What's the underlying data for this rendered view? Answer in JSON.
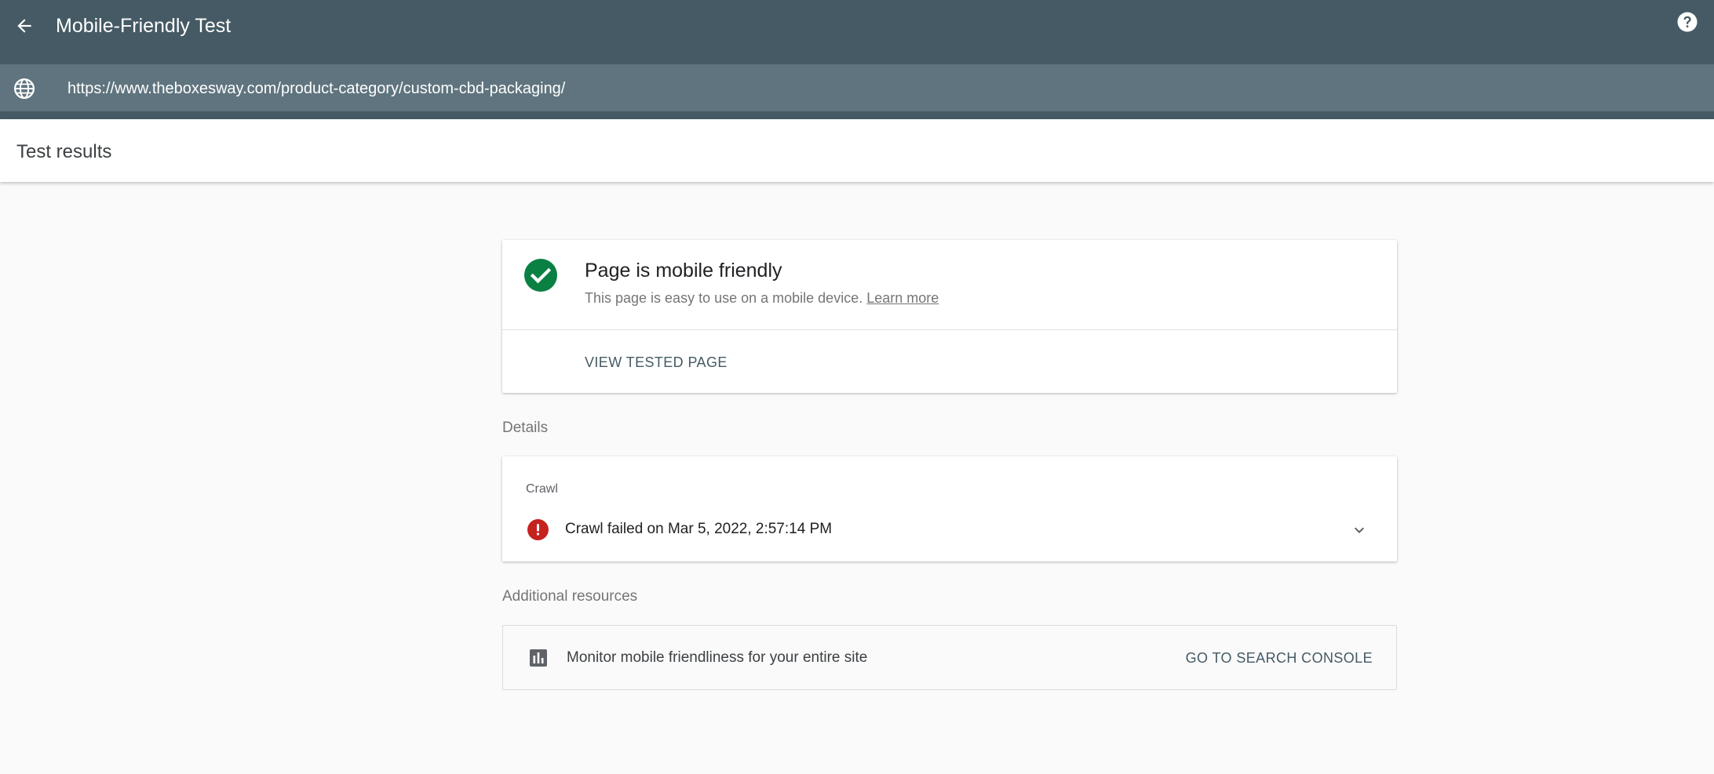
{
  "app_bar": {
    "title": "Mobile-Friendly Test",
    "back_icon": "arrow-back-icon",
    "help_icon": "help-icon"
  },
  "url_bar": {
    "url": "https://www.theboxesway.com/product-category/custom-cbd-packaging/",
    "icon": "globe-icon"
  },
  "results_header": {
    "title": "Test results"
  },
  "summary": {
    "title": "Page is mobile friendly",
    "description": "This page is easy to use on a mobile device.",
    "learn_more": "Learn more",
    "view_tested_page": "VIEW TESTED PAGE",
    "status_color": "#0b8043"
  },
  "details": {
    "label": "Details",
    "crawl": {
      "label": "Crawl",
      "status_text": "Crawl failed on Mar 5, 2022, 2:57:14 PM",
      "status_color": "#c5221f"
    }
  },
  "additional_resources": {
    "label": "Additional resources",
    "item_text": "Monitor mobile friendliness for your entire site",
    "action_label": "GO TO SEARCH CONSOLE"
  },
  "colors": {
    "app_bar": "#455a64",
    "url_bar": "#5f747e",
    "background": "#fafafa"
  }
}
